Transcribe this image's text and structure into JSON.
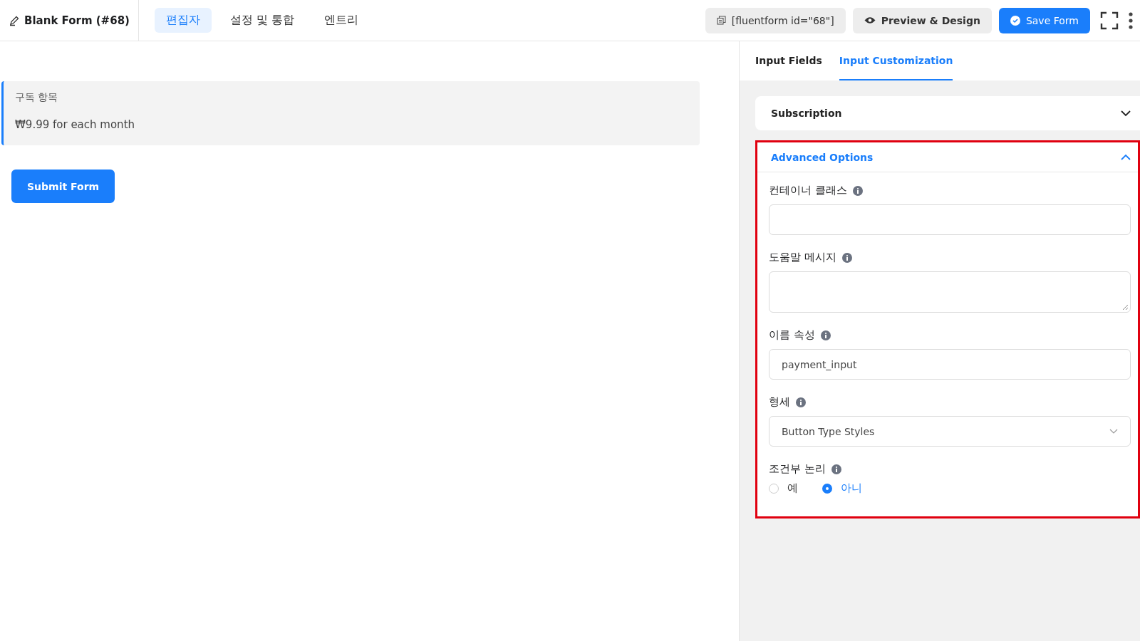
{
  "header": {
    "title": "Blank Form (#68)",
    "tabs": [
      {
        "label": "편집자",
        "selected": true
      },
      {
        "label": "설정 및 통합",
        "selected": false
      },
      {
        "label": "엔트리",
        "selected": false
      }
    ],
    "shortcode": "[fluentform id=\"68\"]",
    "preview_button": "Preview & Design",
    "save_button": "Save Form"
  },
  "canvas": {
    "item_label": "구독 항목",
    "item_price": "₩9.99 for each month",
    "submit_button": "Submit Form"
  },
  "sidebar": {
    "tabs": [
      {
        "label": "Input Fields",
        "selected": false
      },
      {
        "label": "Input Customization",
        "selected": true
      }
    ],
    "sections": [
      {
        "title": "Subscription",
        "expanded": false,
        "highlighted": false
      },
      {
        "title": "Advanced Options",
        "expanded": true,
        "highlighted": true,
        "fields": [
          {
            "kind": "input",
            "label": "컨테이너 클래스"
          },
          {
            "kind": "textarea",
            "label": "도움말 메시지"
          },
          {
            "kind": "input",
            "label": "이름 속성",
            "value": "payment_input"
          },
          {
            "kind": "select",
            "label": "형세",
            "value": "Button Type Styles"
          },
          {
            "kind": "radio",
            "label": "조건부 논리",
            "options": [
              {
                "label": "예",
                "selected": false
              },
              {
                "label": "아니",
                "selected": true
              }
            ]
          }
        ]
      }
    ]
  }
}
